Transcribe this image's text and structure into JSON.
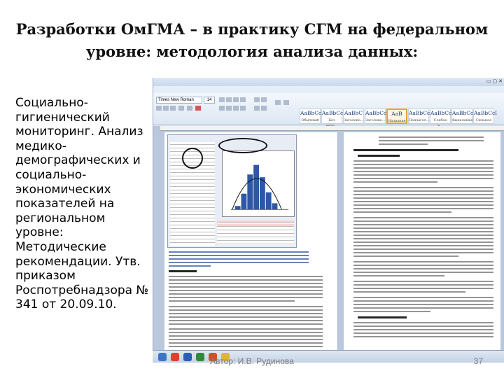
{
  "slide": {
    "title_line1": "Разработки ОмГМА – в практику СГМ на федеральном",
    "title_line2": "уровне: методология анализа данных:",
    "description": "Социально-гигиенический мониторинг. Анализ медико-демографических и социально-экономических показателей на региональном уровне: Методические рекомендации. Утв. приказом Роспотребнадзора № 341 от 20.09.10.",
    "footer_author": "Автор: И.В. Рудинова",
    "page_number": "37"
  },
  "screenshot": {
    "ribbon": {
      "font_value": "Times New Roman",
      "size_value": "14",
      "styles": [
        {
          "sample": "AaBbCcI",
          "name": "Обычный"
        },
        {
          "sample": "AaBbCcI",
          "name": "Без инте..."
        },
        {
          "sample": "AaBbC",
          "name": "Заголово..."
        },
        {
          "sample": "AaBbCc",
          "name": "Заголово..."
        },
        {
          "sample": "AaB",
          "name": "Название"
        },
        {
          "sample": "AaBbCcI",
          "name": "Подзагол..."
        },
        {
          "sample": "AaBbCcI",
          "name": "Слабое в..."
        },
        {
          "sample": "AaBbCcI",
          "name": "Выделение"
        },
        {
          "sample": "AaBbCcI",
          "name": "Сильное ..."
        }
      ]
    },
    "accent_colors": {
      "ribbon": "#dce6f3",
      "selected_style": "#e1a33a",
      "histogram": "#2e58a6"
    }
  }
}
